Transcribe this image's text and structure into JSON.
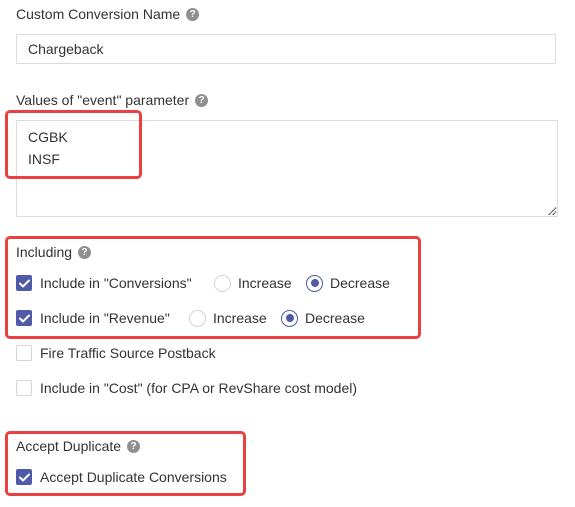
{
  "form": {
    "name_field": {
      "label": "Custom Conversion Name",
      "value": "Chargeback"
    },
    "event_values": {
      "label": "Values of \"event\" parameter",
      "value": "CGBK\nINSF"
    },
    "including": {
      "label": "Including",
      "conversions": {
        "label": "Include in \"Conversions\"",
        "checked": true,
        "options": [
          "Increase",
          "Decrease"
        ],
        "selected": "Decrease"
      },
      "revenue": {
        "label": "Include in \"Revenue\"",
        "checked": true,
        "options": [
          "Increase",
          "Decrease"
        ],
        "selected": "Decrease"
      },
      "postback": {
        "label": "Fire Traffic Source Postback",
        "checked": false
      },
      "cost": {
        "label": "Include in \"Cost\" (for CPA or RevShare cost model)",
        "checked": false
      }
    },
    "accept_duplicate": {
      "label": "Accept Duplicate",
      "option": {
        "label": "Accept Duplicate Conversions",
        "checked": true
      }
    }
  },
  "icons": {
    "help": "?",
    "check": "checkmark-icon"
  },
  "colors": {
    "accent": "#4f5aa8",
    "highlight": "#ea4040",
    "border": "#dcdcdc",
    "help_icon": "#8f8f8f"
  }
}
